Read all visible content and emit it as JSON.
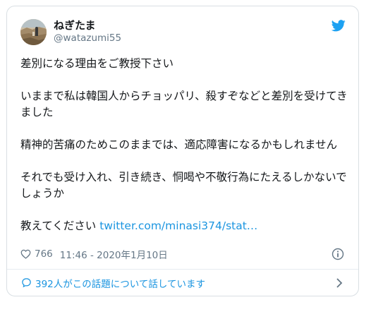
{
  "tweet": {
    "author": {
      "name": "ねぎたま",
      "handle": "@watazumi55"
    },
    "paragraphs": [
      "差別になる理由をご教授下さい",
      "いままで私は韓国人からチョッパリ、殺すぞなどと差別を受けてきました",
      "精神的苦痛のためこのままでは、適応障害になるかもしれません",
      "それでも受け入れ、引き続き、恫喝や不敬行為にたえるしかないでしょうか"
    ],
    "last_line_text": "教えてください ",
    "link_text": "twitter.com/minasi374/stat…",
    "likes": "766",
    "timestamp": "11:46 - 2020年1月10日",
    "conversation_text": "392人がこの話題について話しています"
  },
  "colors": {
    "text": "#14171a",
    "muted": "#657786",
    "link": "#1b95e0",
    "border": "#d9dfe3"
  },
  "icons": [
    "avatar-image",
    "twitter-bird-icon",
    "heart-icon",
    "info-icon",
    "speech-bubble-icon",
    "chevron-right-icon"
  ]
}
